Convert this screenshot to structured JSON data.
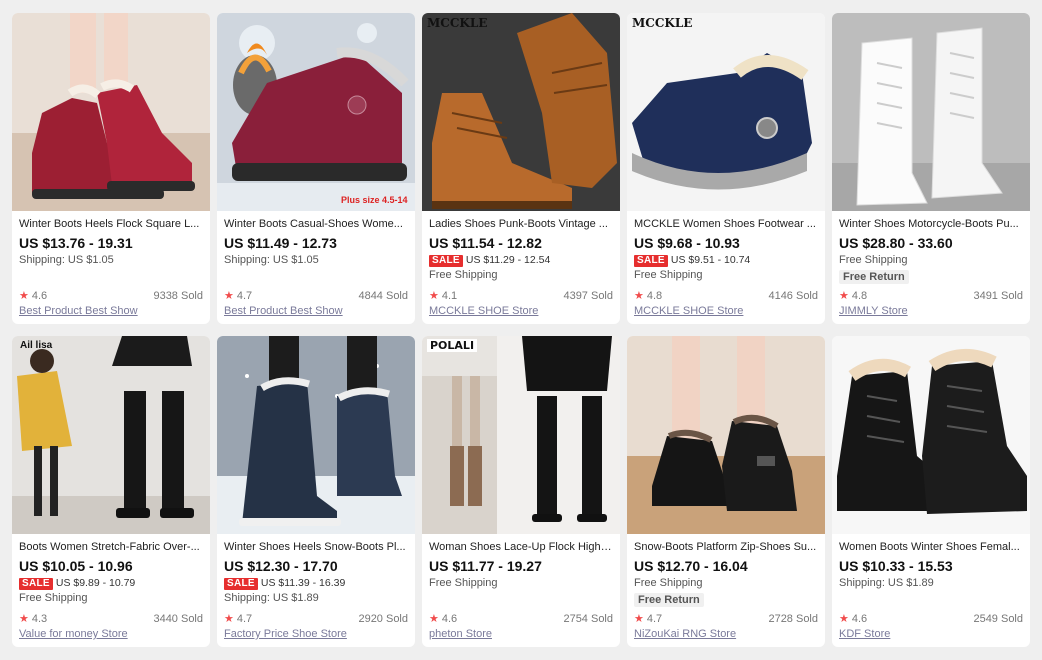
{
  "products": [
    {
      "title": "Winter Boots Heels Flock Square L...",
      "price": "US $13.76 - 19.31",
      "shipping": "Shipping: US $1.05",
      "rating": "4.6",
      "sold": "9338 Sold",
      "store": "Best Product Best Show"
    },
    {
      "title": "Winter Boots Casual-Shoes Wome...",
      "price": "US $11.49 - 12.73",
      "shipping": "Shipping: US $1.05",
      "rating": "4.7",
      "sold": "4844 Sold",
      "store": "Best Product Best Show",
      "overlay": "Plus size 4.5-14"
    },
    {
      "title": "Ladies Shoes Punk-Boots Vintage ...",
      "price": "US $11.54 - 12.82",
      "sale_label": "SALE",
      "sale_price": "US $11.29 - 12.54",
      "shipping": "Free Shipping",
      "rating": "4.1",
      "sold": "4397 Sold",
      "store": "MCCKLE SHOE Store",
      "brand": "MCCKLE"
    },
    {
      "title": "MCCKLE Women Shoes Footwear ...",
      "price": "US $9.68 - 10.93",
      "sale_label": "SALE",
      "sale_price": "US $9.51 - 10.74",
      "shipping": "Free Shipping",
      "rating": "4.8",
      "sold": "4146 Sold",
      "store": "MCCKLE SHOE Store",
      "brand": "MCCKLE"
    },
    {
      "title": "Winter Shoes Motorcycle-Boots Pu...",
      "price": "US $28.80 - 33.60",
      "shipping": "Free Shipping",
      "badge": "Free Return",
      "rating": "4.8",
      "sold": "3491 Sold",
      "store": "JIMMLY Store"
    },
    {
      "title": "Boots Women Stretch-Fabric Over-...",
      "price": "US $10.05 - 10.96",
      "sale_label": "SALE",
      "sale_price": "US $9.89 - 10.79",
      "shipping": "Free Shipping",
      "rating": "4.3",
      "sold": "3440 Sold",
      "store": "Value for money Store",
      "overlay": "Ail    lisa"
    },
    {
      "title": "Winter Shoes Heels Snow-Boots Pl...",
      "price": "US $12.30 - 17.70",
      "sale_label": "SALE",
      "sale_price": "US $11.39 - 16.39",
      "shipping": "Shipping: US $1.89",
      "rating": "4.7",
      "sold": "2920 Sold",
      "store": "Factory Price Shoe Store"
    },
    {
      "title": "Woman Shoes Lace-Up Flock High-...",
      "price": "US $11.77 - 19.27",
      "shipping": "Free Shipping",
      "rating": "4.6",
      "sold": "2754 Sold",
      "store": "pheton Store",
      "brand": "POLALI"
    },
    {
      "title": "Snow-Boots Platform Zip-Shoes Su...",
      "price": "US $12.70 - 16.04",
      "shipping": "Free Shipping",
      "badge": "Free Return",
      "rating": "4.7",
      "sold": "2728 Sold",
      "store": "NiZouKai RNG Store"
    },
    {
      "title": "Women Boots Winter Shoes Femal...",
      "price": "US $10.33 - 15.53",
      "shipping": "Shipping: US $1.89",
      "rating": "4.6",
      "sold": "2549 Sold",
      "store": "KDF Store"
    }
  ],
  "icons": {
    "star": "★"
  },
  "colors": {
    "sale": "#e62e2e",
    "star": "#f14c4c",
    "store_link": "#7a7a9a"
  }
}
